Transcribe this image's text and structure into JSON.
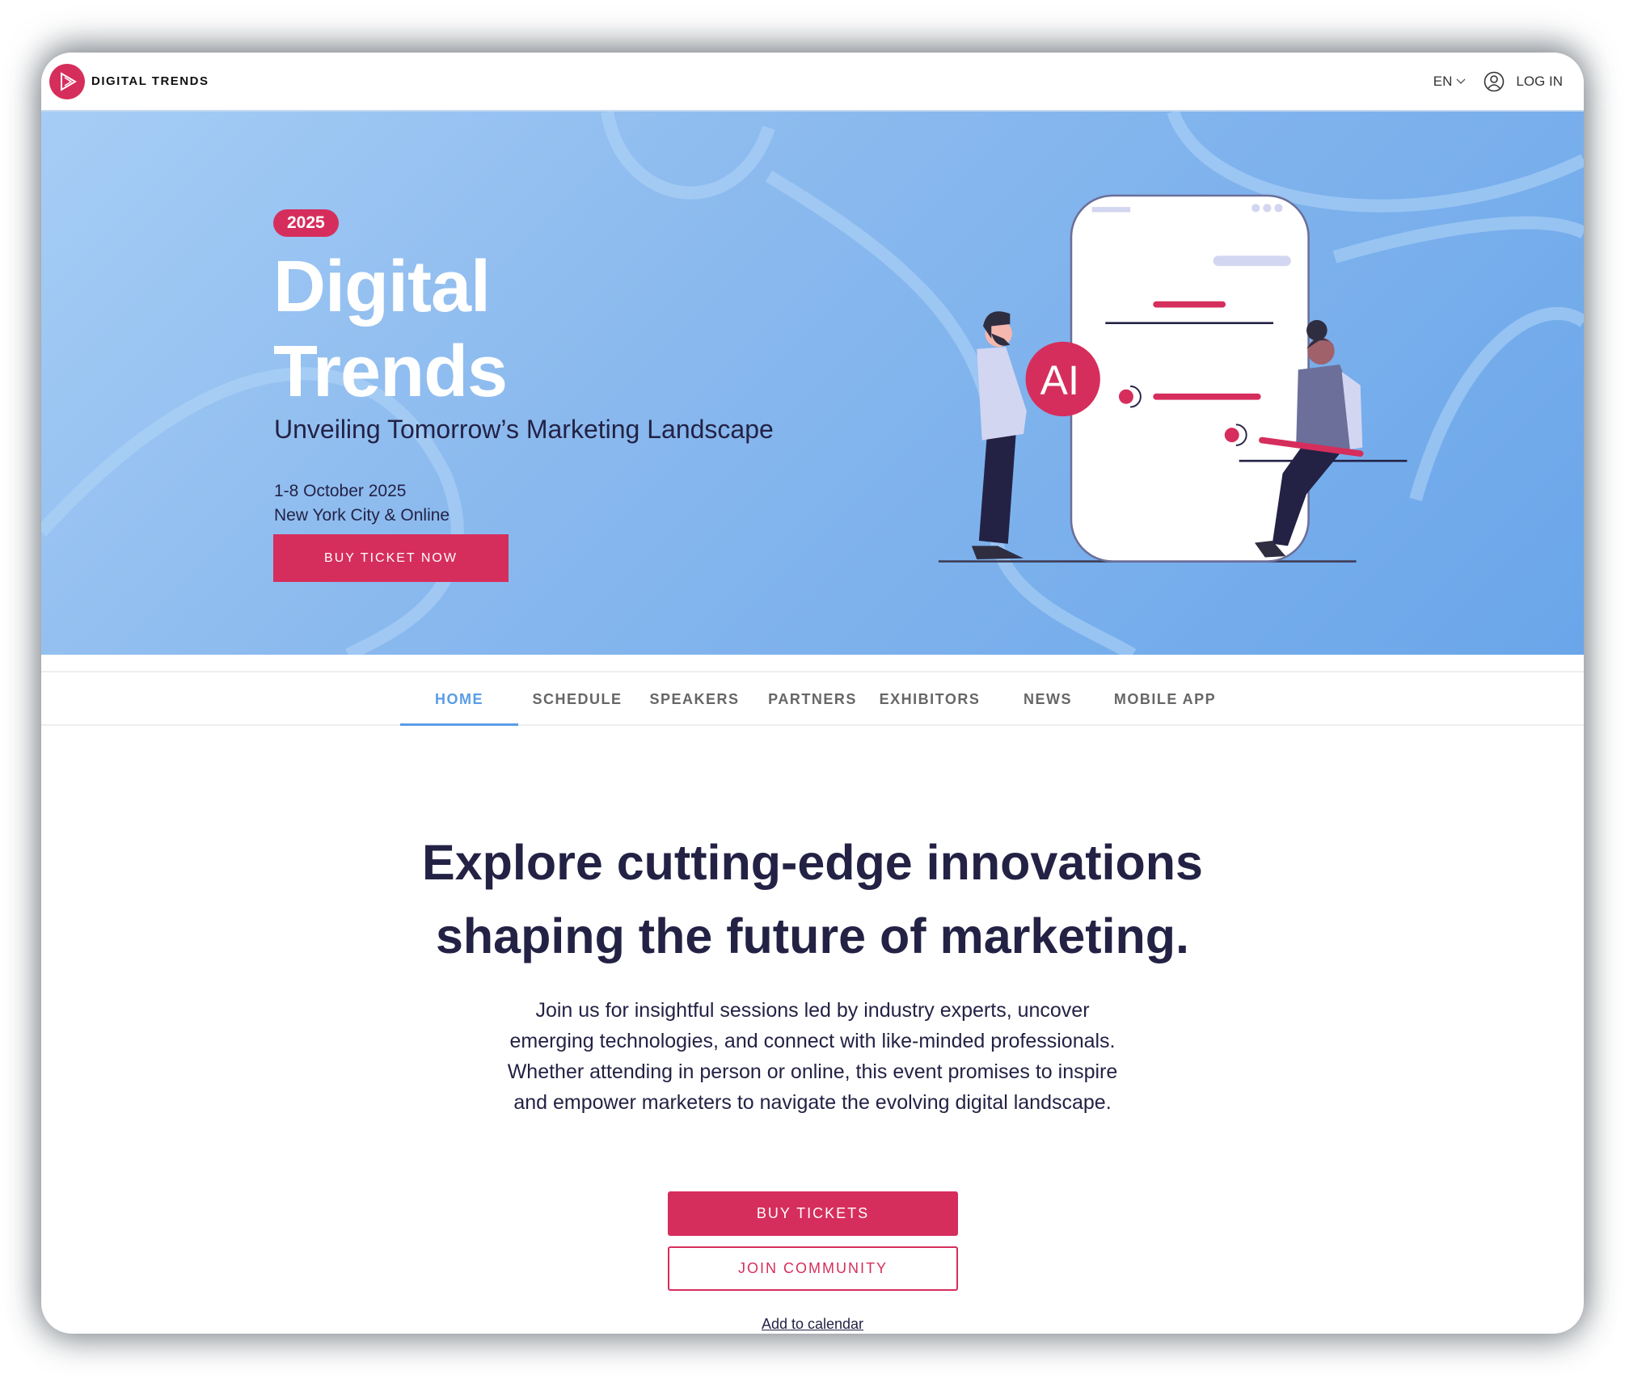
{
  "header": {
    "brand": "DIGITAL TRENDS",
    "language": "EN",
    "login": "LOG IN"
  },
  "hero": {
    "badge": "2025",
    "title_line1": "Digital",
    "title_line2": "Trends",
    "subtitle": "Unveiling Tomorrow’s Marketing Landscape",
    "date": "1-8 October 2025",
    "location": "New York City & Online",
    "cta": "BUY TICKET NOW",
    "illustration_label": "AI"
  },
  "nav": {
    "items": [
      {
        "label": "HOME",
        "active": true
      },
      {
        "label": "SCHEDULE"
      },
      {
        "label": "SPEAKERS"
      },
      {
        "label": "PARTNERS"
      },
      {
        "label": "EXHIBITORS"
      },
      {
        "label": "NEWS"
      },
      {
        "label": "MOBILE APP"
      }
    ]
  },
  "main": {
    "heading_line1": "Explore cutting-edge innovations",
    "heading_line2": "shaping the future of marketing.",
    "paragraph": "Join us for insightful sessions led by industry experts, uncover emerging technologies, and connect with like-minded professionals. Whether attending in person or online, this event promises to inspire and empower marketers to navigate the evolving digital landscape.",
    "buy_tickets": "BUY TICKETS",
    "join_community": "JOIN COMMUNITY",
    "add_to_calendar": "Add to calendar"
  },
  "colors": {
    "accent": "#d62e5c",
    "nav_active": "#5a9de6",
    "text": "#232245",
    "hero_bg": "#8ab9ee"
  }
}
